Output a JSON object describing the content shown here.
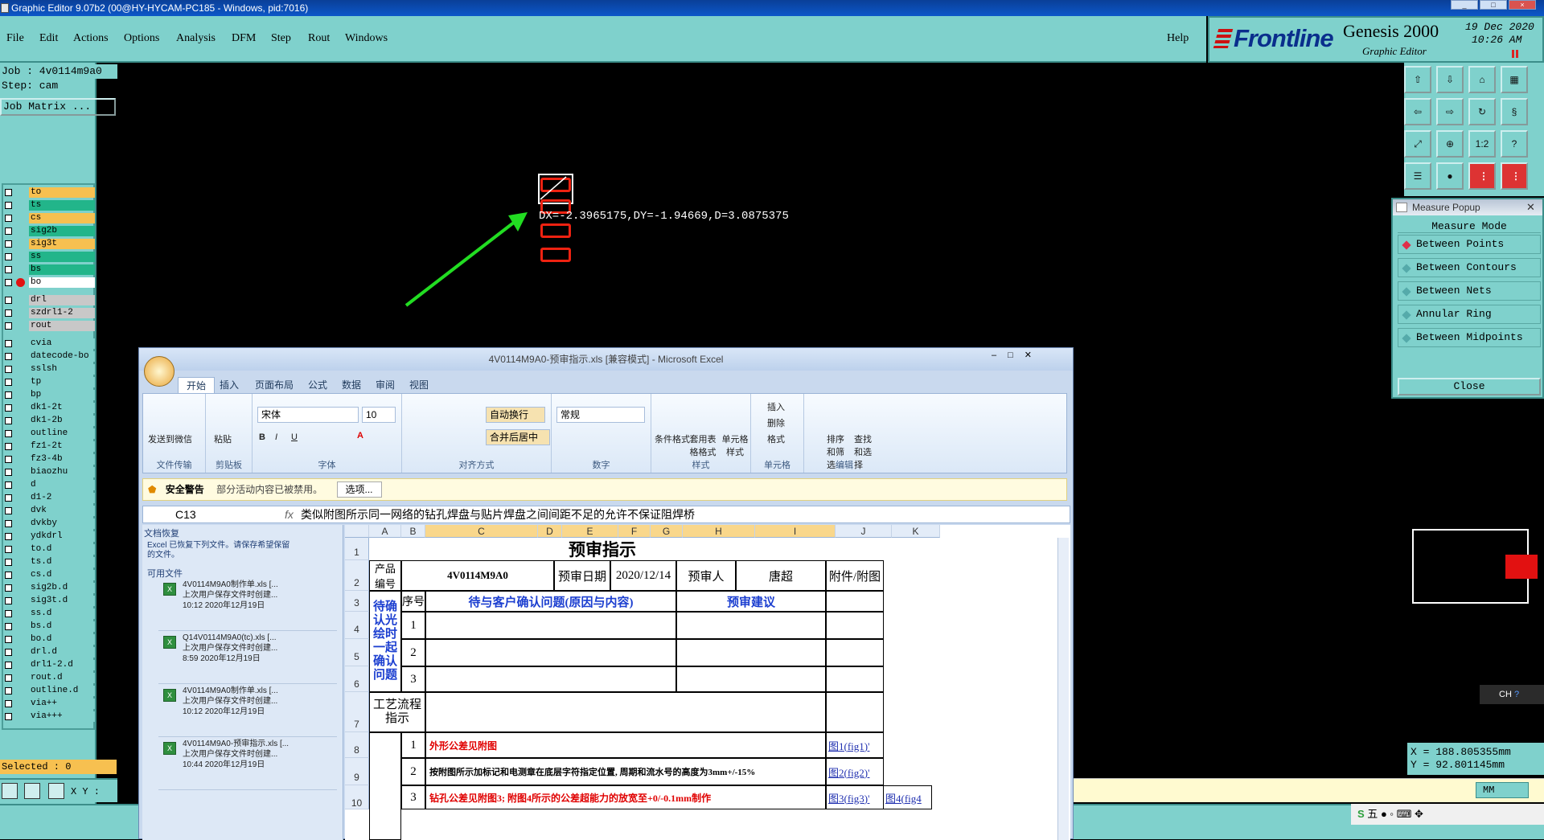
{
  "app": {
    "title": "Graphic Editor 9.07b2 (00@HY-HYCAM-PC185 - Windows, pid:7016)",
    "menu": [
      "File",
      "Edit",
      "Actions",
      "Options",
      "Analysis",
      "DFM",
      "Step",
      "Rout",
      "Windows"
    ],
    "help": "Help",
    "brand": "Frontline",
    "product": "Genesis 2000",
    "subtitle": "Graphic Editor",
    "date": "19 Dec 2020",
    "time": "10:26 AM"
  },
  "job": {
    "job_line": "Job : 4v0114m9a0",
    "step_line": "Step: cam",
    "matrix": "Job Matrix ...",
    "layers": [
      "to",
      "ts",
      "cs",
      "sig2b",
      "sig3t",
      "ss",
      "bs",
      "bo",
      "drl",
      "szdrl1-2",
      "rout",
      "cvia",
      "datecode-bo",
      "sslsh",
      "tp",
      "bp",
      "dk1-2t",
      "dk1-2b",
      "outline",
      "fz1-2t",
      "fz3-4b",
      "biaozhu",
      "d",
      "d1-2",
      "dvk",
      "dvkby",
      "ydkdrl",
      "to.d",
      "ts.d",
      "cs.d",
      "sig2b.d",
      "sig3t.d",
      "ss.d",
      "bs.d",
      "bo.d",
      "drl.d",
      "drl1-2.d",
      "rout.d",
      "outline.d",
      "via++",
      "via+++"
    ],
    "selected": "Selected : 0",
    "xy_label": "X Y :"
  },
  "colors": {
    "teal": "#7fd1cc",
    "layer_orange": "#f7c050",
    "layer_green": "#22b58a",
    "layer_grey": "#c8c8c8",
    "measure_red": "#e21111",
    "arrow_green": "#22dd22"
  },
  "canvas": {
    "measure_text": "DX=-2.3965175,DY=-1.94669,D=3.0875375"
  },
  "tools": {
    "scale_label": "1:2",
    "help_label": "?"
  },
  "measure_popup": {
    "title": "Measure Popup",
    "heading": "Measure Mode",
    "options": [
      "Between Points",
      "Between Contours",
      "Between Nets",
      "Annular Ring",
      "Between Midpoints"
    ],
    "close": "Close"
  },
  "coords": {
    "x": "X = 188.805355mm",
    "y": "Y = 92.801145mm"
  },
  "units": "MM",
  "ime": {
    "lang": "CH",
    "mode": "五"
  },
  "excel": {
    "title": "4V0114M9A0-预审指示.xls [兼容模式] - Microsoft Excel",
    "tabs": [
      "开始",
      "插入",
      "页面布局",
      "公式",
      "数据",
      "审阅",
      "视图"
    ],
    "font_name": "宋体",
    "font_size": "10",
    "number_format": "常规",
    "wrap": "自动换行",
    "merge": "合并后居中",
    "groups": [
      "文件传输",
      "剪贴板",
      "字体",
      "对齐方式",
      "数字",
      "样式",
      "单元格",
      "编辑"
    ],
    "buttons": {
      "send": "发送到微信",
      "paste": "粘贴",
      "cond_fmt": "条件格式",
      "table_fmt": "套用表格格式",
      "cell_style": "单元格样式",
      "insert": "插入",
      "delete": "删除",
      "format": "格式",
      "sort": "排序和筛选",
      "find": "查找和选择"
    },
    "security": {
      "label": "安全警告",
      "text": "部分活动内容已被禁用。",
      "options": "选项..."
    },
    "namebox": "C13",
    "formula": "类似附图所示同一网络的钻孔焊盘与贴片焊盘之间间距不足的允许不保证阻焊桥",
    "recovery": {
      "title": "文档恢复",
      "desc": "Excel 已恢复下列文件。请保存希望保留的文件。",
      "available": "可用文件",
      "files": [
        {
          "name": "4V0114M9A0制作单.xls  [...",
          "desc": "上次用户保存文件时创建...",
          "time": "10:12 2020年12月19日"
        },
        {
          "name": "Q14V0114M9A0(tc).xls  [...",
          "desc": "上次用户保存文件时创建...",
          "time": "8:59 2020年12月19日"
        },
        {
          "name": "4V0114M9A0制作单.xls  [...",
          "desc": "上次用户保存文件时创建...",
          "time": "10:12 2020年12月19日"
        },
        {
          "name": "4V0114M9A0-预审指示.xls  [...",
          "desc": "上次用户保存文件时创建...",
          "time": "10:44 2020年12月19日"
        }
      ]
    },
    "columns": [
      "A",
      "B",
      "C",
      "D",
      "E",
      "F",
      "G",
      "H",
      "I",
      "J",
      "K"
    ],
    "rows": [
      "1",
      "2",
      "3",
      "4",
      "5",
      "6",
      "7",
      "8",
      "9",
      "10"
    ],
    "sheet": {
      "title": "预审指示",
      "product_label": "产品编号",
      "product_value": "4V0114M9A0",
      "review_date_label": "预审日期",
      "review_date": "2020/12/14",
      "reviewer_label": "预审人",
      "reviewer": "唐超",
      "attach_label": "附件/附图",
      "seq": "序号",
      "issue_header": "待与客户确认问题(原因与内容)",
      "advice_header": "预审建议",
      "confirm_label": "待确认光绘时一起确认问题",
      "process_label": "工艺流程指示",
      "n1": "1",
      "n2": "2",
      "n3": "3",
      "item1": "外形公差见附图",
      "item2": "按附图所示加标记和电测章在底层字符指定位置, 周期和流水号的高度为3mm+/-15%",
      "item3": "钻孔公差见附图3; 附图4所示的公差超能力的放宽至+0/-0.1mm制作",
      "link1": "图1(fig1)'",
      "link2": "图2(fig2)'",
      "link3": "图3(fig3)'",
      "link4": "图4(fig4"
    }
  }
}
